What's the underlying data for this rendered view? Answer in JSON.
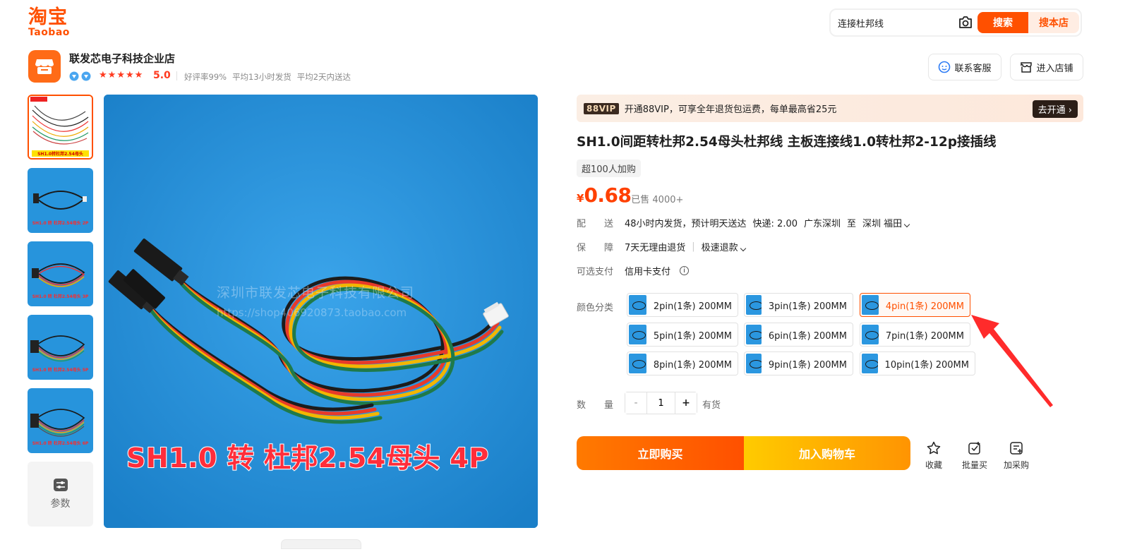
{
  "header": {
    "logo_cn": "淘宝",
    "logo_en": "Taobao",
    "search_value": "连接杜邦线",
    "search_button": "搜索",
    "shop_search_button": "搜本店"
  },
  "store": {
    "name": "联发芯电子科技企业店",
    "rating": "5.0",
    "stars": 5,
    "metrics": [
      "好评率99%",
      "平均13小时发货",
      "平均2天内送达"
    ],
    "contact_button": "联系客服",
    "enter_shop_button": "进入店铺"
  },
  "gallery": {
    "thumbs": [
      {
        "label": "SH1.0转杜邦2.54母头",
        "active": true
      },
      {
        "label": "SH1.0 转 杜邦2.54母头 2P",
        "active": false
      },
      {
        "label": "SH1.0 转 杜邦2.54母头 3P",
        "active": false
      },
      {
        "label": "SH1.0 转 杜邦2.54母头 5P",
        "active": false
      },
      {
        "label": "SH1.0 转 杜邦2.54母头 6P",
        "active": false
      }
    ],
    "params_label": "参数",
    "watermark_line1": "深圳市联发芯电子科技有限公司",
    "watermark_line2": "https://shop406920873.taobao.com",
    "caption": "SH1.0 转 杜邦2.54母头 4P"
  },
  "vip": {
    "tag": "88VIP",
    "text": "开通88VIP，可享全年退货包运费，每单最高省25元",
    "button": "去开通"
  },
  "product": {
    "title": "SH1.0间距转杜邦2.54母头杜邦线 主板连接线1.0转杜邦2-12p接插线",
    "buyers_tag": "超100人加购",
    "currency": "¥",
    "price": "0.68",
    "sold": "· 已售 4000+",
    "delivery_label": "配　　送",
    "delivery_text": "48小时内发货，预计明天送达",
    "delivery_fee": "快递: 2.00",
    "delivery_from": "广东深圳",
    "delivery_to_word": "至",
    "delivery_to": "深圳 福田",
    "guarantee_label": "保　　障",
    "guarantee_text": "7天无理由退货",
    "guarantee_extra": "极速退款",
    "payment_label": "可选支付",
    "payment_text": "信用卡支付",
    "sku_label": "颜色分类",
    "skus": [
      {
        "label": "2pin(1条) 200MM",
        "selected": false
      },
      {
        "label": "3pin(1条) 200MM",
        "selected": false
      },
      {
        "label": "4pin(1条) 200MM",
        "selected": true
      },
      {
        "label": "5pin(1条) 200MM",
        "selected": false
      },
      {
        "label": "6pin(1条) 200MM",
        "selected": false
      },
      {
        "label": "7pin(1条) 200MM",
        "selected": false
      },
      {
        "label": "8pin(1条) 200MM",
        "selected": false
      },
      {
        "label": "9pin(1条) 200MM",
        "selected": false
      },
      {
        "label": "10pin(1条) 200MM",
        "selected": false
      }
    ],
    "qty_label": "数　　量",
    "qty_minus": "-",
    "qty_value": "1",
    "qty_plus": "+",
    "stock": "有货",
    "buy_now": "立即购买",
    "add_to_cart": "加入购物车",
    "actions": [
      "收藏",
      "批量买",
      "加采购"
    ]
  },
  "colors": {
    "brand": "#ff5000",
    "price": "#ff4000",
    "image_bg": "#2b97e0"
  }
}
